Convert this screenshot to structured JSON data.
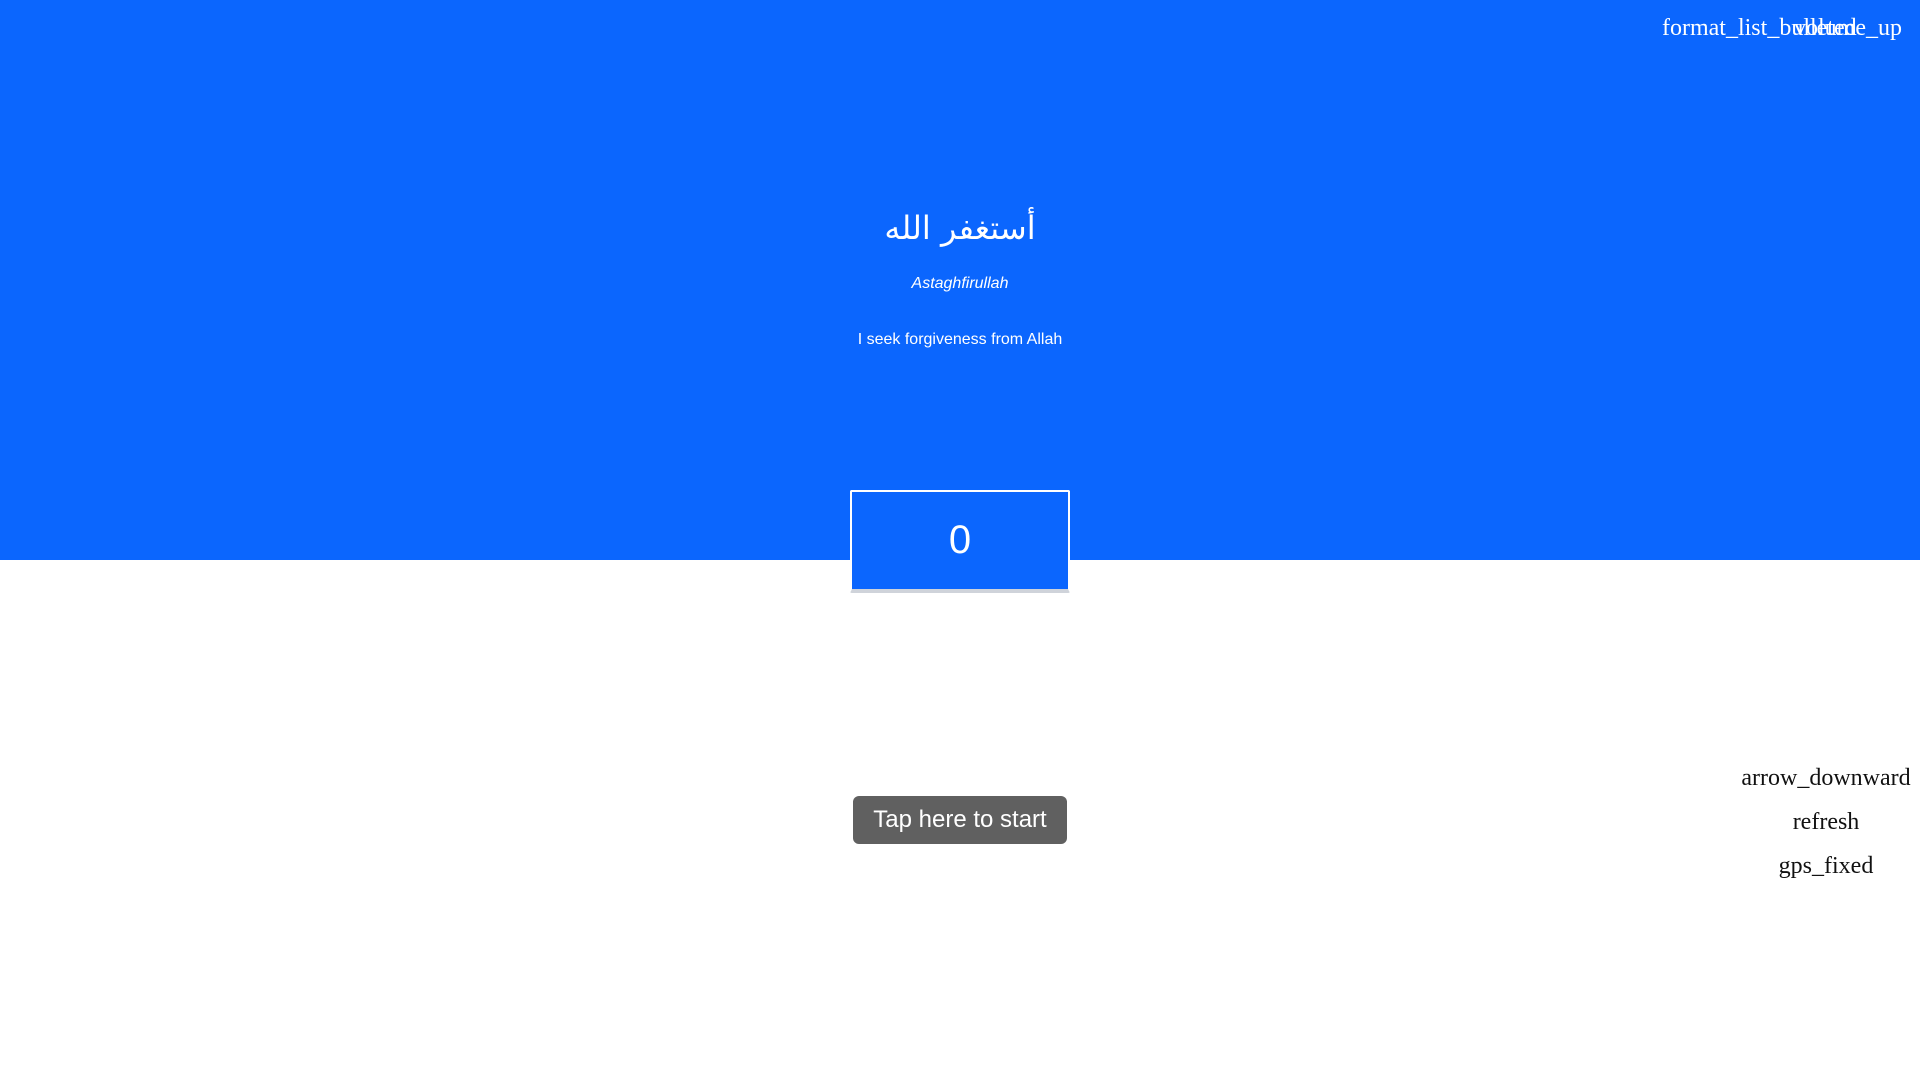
{
  "header": {
    "list_icon_name": "format_list_bulleted",
    "volume_icon_name": "volume_up"
  },
  "dhikr": {
    "arabic": "أستغفر الله",
    "transliteration": "Astaghfirullah",
    "translation": "I seek forgiveness from Allah"
  },
  "counter": {
    "value": "0"
  },
  "start_button": {
    "label": "Tap here to start"
  },
  "side_controls": {
    "arrow_icon_name": "arrow_downward",
    "refresh_icon_name": "refresh",
    "gps_icon_name": "gps_fixed"
  },
  "colors": {
    "primary_blue": "#0b66fe",
    "button_gray": "#606060",
    "background": "#ffffff"
  }
}
